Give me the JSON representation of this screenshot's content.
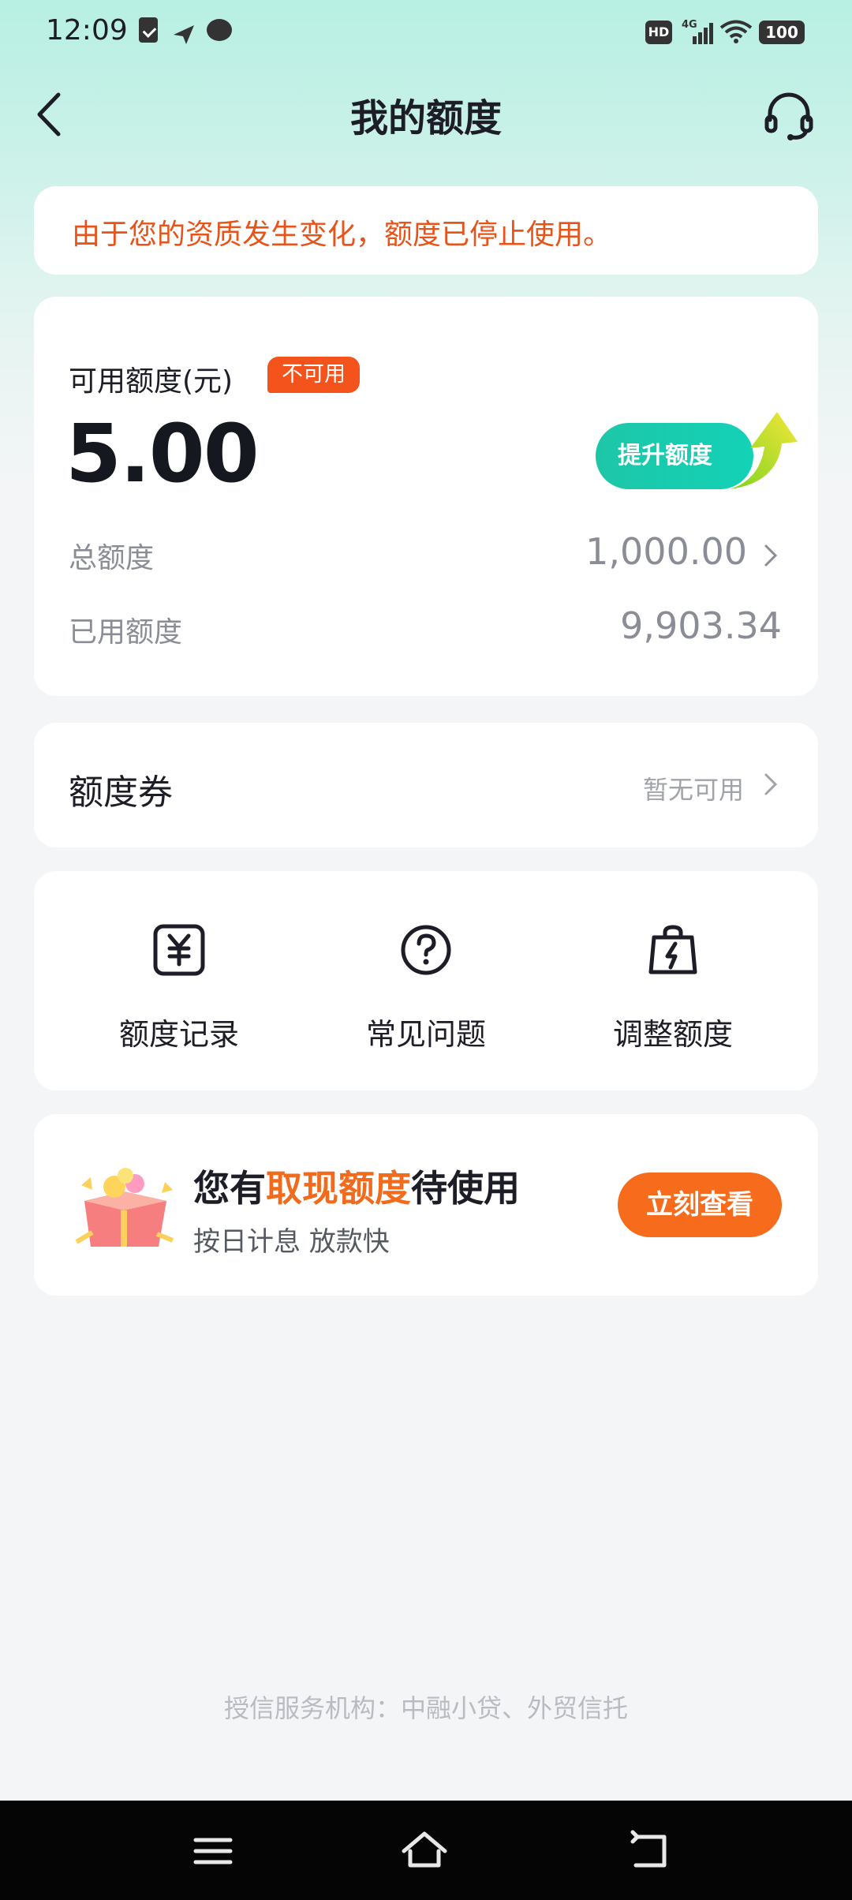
{
  "status_bar": {
    "time": "12:09",
    "network": "4G",
    "hd": "HD",
    "battery": "100"
  },
  "nav": {
    "title": "我的额度"
  },
  "notice": {
    "text": "由于您的资质发生变化，额度已停止使用。"
  },
  "limit": {
    "label": "可用额度(元)",
    "badge": "不可用",
    "amount": "5.00",
    "raise_button": "提升额度",
    "total_label": "总额度",
    "total_value": "1,000.00",
    "used_label": "已用额度",
    "used_value": "9,903.34"
  },
  "coupon": {
    "title": "额度券",
    "status": "暂无可用"
  },
  "shortcuts": [
    {
      "label": "额度记录",
      "icon": "yuan-receipt-icon"
    },
    {
      "label": "常见问题",
      "icon": "question-circle-icon"
    },
    {
      "label": "调整额度",
      "icon": "lightning-bag-icon"
    }
  ],
  "promo": {
    "title_prefix": "您有",
    "title_highlight": "取现额度",
    "title_suffix": "待使用",
    "subtitle": "按日计息 放款快",
    "button": "立刻查看"
  },
  "footer": {
    "text": "授信服务机构：中融小贷、外贸信托"
  },
  "colors": {
    "accent_orange": "#f26b1d",
    "notice_red": "#e8531a",
    "teal": "#1ec6a8"
  }
}
